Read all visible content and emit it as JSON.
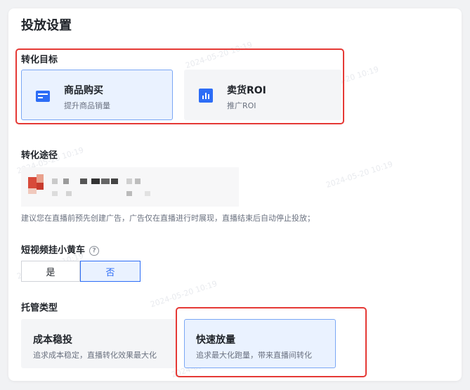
{
  "panel": {
    "title": "投放设置"
  },
  "conversion_goal": {
    "label": "转化目标",
    "options": [
      {
        "title": "商品购买",
        "desc": "提升商品销量",
        "icon": "card-icon",
        "selected": true
      },
      {
        "title": "卖货ROI",
        "desc": "推广ROI",
        "icon": "bar-chart-icon",
        "selected": false
      }
    ]
  },
  "conversion_path": {
    "label": "转化途径",
    "hint": "建议您在直播前预先创建广告，广告仅在直播进行时展现，直播结束后自动停止投放；"
  },
  "short_video_cart": {
    "label": "短视频挂小黄车",
    "help_icon": "?",
    "options": [
      "是",
      "否"
    ],
    "selected": "否"
  },
  "bid_type": {
    "label": "托管类型",
    "options": [
      {
        "title": "成本稳投",
        "desc": "追求成本稳定，直播转化效果最大化",
        "selected": false
      },
      {
        "title": "快速放量",
        "desc": "追求最大化跑量，带来直播间转化",
        "selected": true
      }
    ]
  },
  "colors": {
    "accent": "#2d6df6",
    "selected_bg": "#eaf2ff",
    "highlight_frame": "#e53935"
  }
}
